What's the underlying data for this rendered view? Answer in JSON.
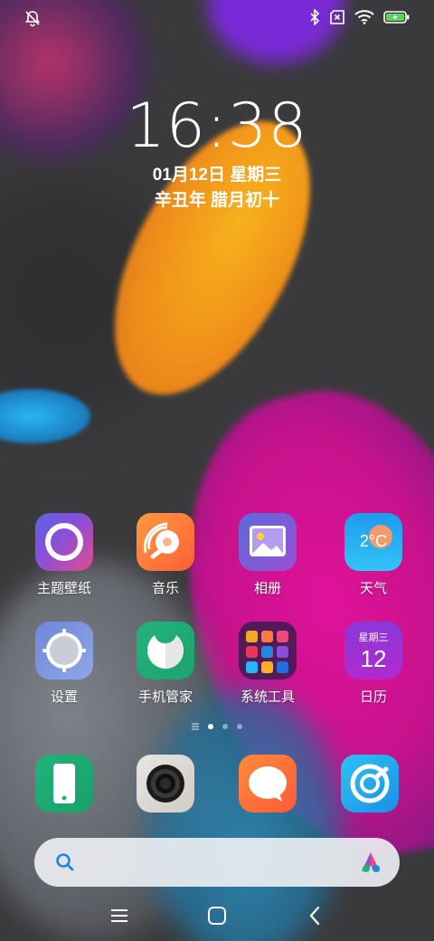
{
  "status_bar": {
    "left_icon": "bell-off-icon",
    "right_icons": [
      "bluetooth-icon",
      "no-sim-icon",
      "wifi-icon",
      "battery-charging-icon"
    ]
  },
  "lock_clock": {
    "time": "16:38",
    "date": "01月12日 星期三",
    "lunar": "辛丑年 腊月初十"
  },
  "apps": {
    "row1": [
      {
        "label": "主题壁纸",
        "icon": "themes-icon"
      },
      {
        "label": "音乐",
        "icon": "music-icon"
      },
      {
        "label": "相册",
        "icon": "gallery-icon"
      },
      {
        "label": "天气",
        "icon": "weather-icon",
        "badge": "2°C"
      }
    ],
    "row2": [
      {
        "label": "设置",
        "icon": "settings-icon"
      },
      {
        "label": "手机管家",
        "icon": "security-icon"
      },
      {
        "label": "系统工具",
        "icon": "folder-icon"
      },
      {
        "label": "日历",
        "icon": "calendar-icon",
        "weekday": "星期三",
        "day": "12"
      }
    ]
  },
  "page_indicator": {
    "pages": 3,
    "active": 1
  },
  "dock": [
    {
      "icon": "phone-icon"
    },
    {
      "icon": "camera-icon"
    },
    {
      "icon": "messages-icon"
    },
    {
      "icon": "browser-icon"
    }
  ],
  "search_bar": {
    "left_icon": "search-icon",
    "right_icon": "assistant-icon"
  },
  "nav_bar": {
    "buttons": [
      "menu-icon",
      "home-icon",
      "back-icon"
    ]
  },
  "colors": {
    "accent_blue": "#1e88e5",
    "orange": "#ff7a3d",
    "green": "#22b27a"
  }
}
